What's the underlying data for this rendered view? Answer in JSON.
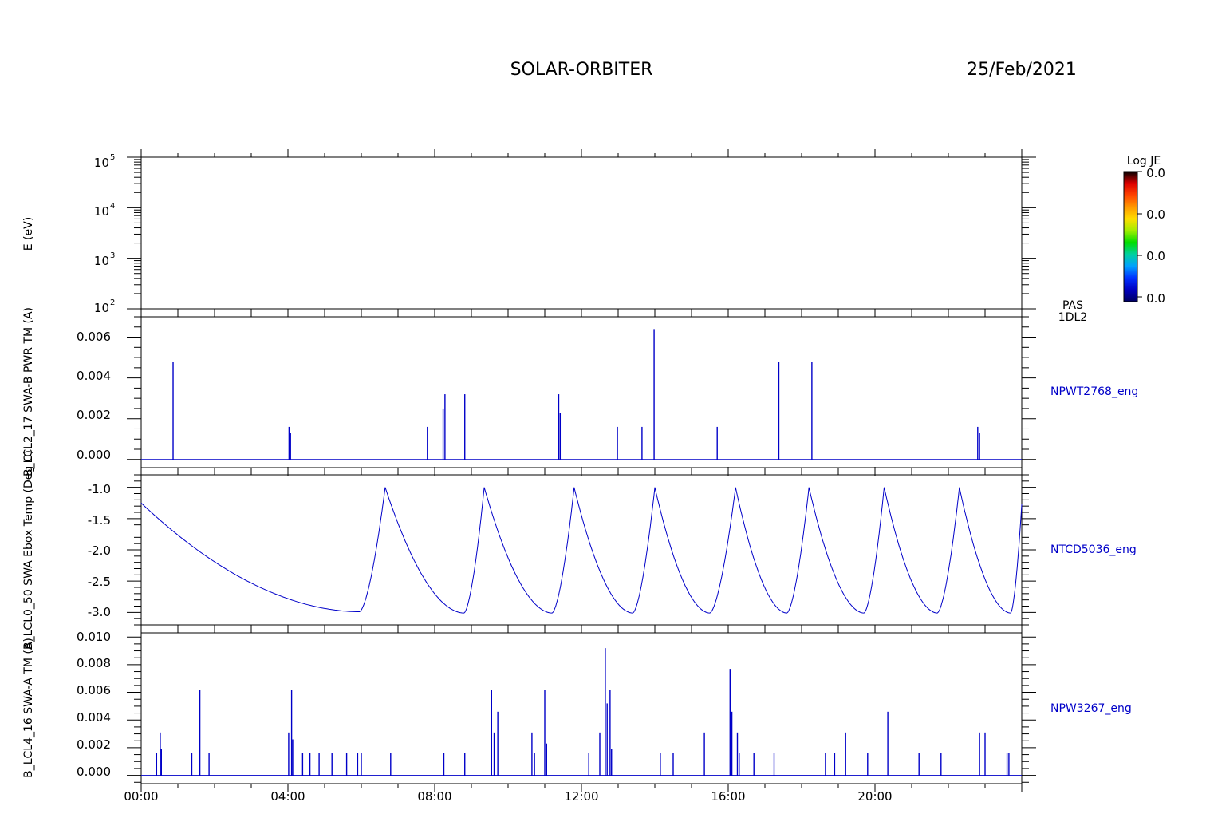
{
  "header": {
    "mission": "SOLAR-ORBITER",
    "date": "25/Feb/2021"
  },
  "colorbar": {
    "title": "Log JE",
    "tick_labels": [
      "0.0",
      "0.0",
      "0.0",
      "0.0"
    ],
    "colors": [
      "#000000",
      "#dd0000",
      "#ff4400",
      "#ff9900",
      "#ffdd00",
      "#a0ee00",
      "#00dd00",
      "#00d0a0",
      "#00a0ff",
      "#0030ff",
      "#0000c0",
      "#000060"
    ]
  },
  "x_axis": {
    "tick_labels": [
      "00:00",
      "04:00",
      "08:00",
      "12:00",
      "16:00",
      "20:00"
    ],
    "range_hours": [
      0,
      24
    ]
  },
  "chart_data": [
    {
      "type": "heatmap",
      "ylabel": "E (eV)",
      "yscale": "log",
      "ylim": [
        100,
        100000
      ],
      "tick_labels": [
        {
          "base": "10",
          "exp": "5"
        },
        {
          "base": "10",
          "exp": "4"
        },
        {
          "base": "10",
          "exp": "3"
        },
        {
          "base": "10",
          "exp": "2"
        }
      ],
      "side_label": [
        "PAS",
        "1DL2"
      ],
      "values": []
    },
    {
      "type": "line",
      "ylabel": "NPWT2768_eng",
      "left_label": "B_LCL2_17 SWA-B PWR TM (A)",
      "ylim": [
        -0.0004,
        0.007
      ],
      "tick_labels": [
        "0.006",
        "0.004",
        "0.002",
        "0.000"
      ],
      "tick_values": [
        0.006,
        0.004,
        0.002,
        0.0
      ],
      "spikes": [
        [
          0.87,
          0.0048
        ],
        [
          4.03,
          0.0016
        ],
        [
          4.07,
          0.0013
        ],
        [
          7.8,
          0.0016
        ],
        [
          8.23,
          0.0025
        ],
        [
          8.28,
          0.0032
        ],
        [
          8.82,
          0.0032
        ],
        [
          11.38,
          0.0032
        ],
        [
          11.42,
          0.0023
        ],
        [
          12.98,
          0.0016
        ],
        [
          13.65,
          0.0016
        ],
        [
          13.98,
          0.0064
        ],
        [
          15.7,
          0.0016
        ],
        [
          17.38,
          0.0048
        ],
        [
          18.28,
          0.0048
        ],
        [
          22.8,
          0.0016
        ],
        [
          22.85,
          0.0013
        ]
      ]
    },
    {
      "type": "line",
      "ylabel": "NTCD5036_eng",
      "left_label": "B_LCL0_50 SWA Ebox Temp (Deg C)",
      "ylim": [
        -3.2,
        -0.8
      ],
      "tick_labels": [
        "-1.0",
        "-1.5",
        "-2.0",
        "-2.5",
        "-3.0"
      ],
      "tick_values": [
        -1.0,
        -1.5,
        -2.0,
        -2.5,
        -3.0
      ],
      "peaks": [
        [
          6.65,
          -1.0
        ],
        [
          9.35,
          -1.0
        ],
        [
          11.8,
          -1.0
        ],
        [
          14.0,
          -1.0
        ],
        [
          16.2,
          -1.0
        ],
        [
          18.2,
          -1.0
        ],
        [
          20.25,
          -1.0
        ],
        [
          22.3,
          -1.0
        ]
      ],
      "troughs": [
        [
          5.95,
          -2.99
        ],
        [
          8.8,
          -3.01
        ],
        [
          11.2,
          -3.01
        ],
        [
          13.4,
          -3.01
        ],
        [
          15.5,
          -3.01
        ],
        [
          17.6,
          -3.01
        ],
        [
          19.7,
          -3.01
        ],
        [
          21.7,
          -3.01
        ],
        [
          23.7,
          -3.01
        ]
      ],
      "start": [
        0.0,
        -1.25
      ],
      "end": [
        24.0,
        -1.27
      ]
    },
    {
      "type": "line",
      "ylabel": "NPW3267_eng",
      "left_label": "B_LCL4_16 SWA-A TM (A)",
      "ylim": [
        -0.0006,
        0.0103
      ],
      "tick_labels": [
        "0.010",
        "0.008",
        "0.006",
        "0.004",
        "0.002",
        "0.000"
      ],
      "tick_values": [
        0.01,
        0.008,
        0.006,
        0.004,
        0.002,
        0.0
      ],
      "spikes": [
        [
          0.42,
          0.0016
        ],
        [
          0.52,
          0.0031
        ],
        [
          0.55,
          0.0019
        ],
        [
          1.38,
          0.0016
        ],
        [
          1.6,
          0.0062
        ],
        [
          1.85,
          0.0016
        ],
        [
          4.02,
          0.0031
        ],
        [
          4.1,
          0.0062
        ],
        [
          4.13,
          0.0026
        ],
        [
          4.4,
          0.0016
        ],
        [
          4.6,
          0.0016
        ],
        [
          4.85,
          0.0016
        ],
        [
          5.2,
          0.0016
        ],
        [
          5.6,
          0.0016
        ],
        [
          5.9,
          0.0016
        ],
        [
          6.0,
          0.0016
        ],
        [
          6.8,
          0.0016
        ],
        [
          8.25,
          0.0016
        ],
        [
          8.82,
          0.0016
        ],
        [
          9.55,
          0.0062
        ],
        [
          9.62,
          0.0031
        ],
        [
          9.72,
          0.0046
        ],
        [
          10.65,
          0.0031
        ],
        [
          10.72,
          0.0016
        ],
        [
          11.0,
          0.0062
        ],
        [
          11.05,
          0.0023
        ],
        [
          12.2,
          0.0016
        ],
        [
          12.5,
          0.0031
        ],
        [
          12.65,
          0.0092
        ],
        [
          12.7,
          0.0052
        ],
        [
          12.78,
          0.0062
        ],
        [
          12.82,
          0.0019
        ],
        [
          14.15,
          0.0016
        ],
        [
          14.5,
          0.0016
        ],
        [
          15.35,
          0.0031
        ],
        [
          16.05,
          0.0077
        ],
        [
          16.1,
          0.0046
        ],
        [
          16.25,
          0.0031
        ],
        [
          16.3,
          0.0016
        ],
        [
          16.7,
          0.0016
        ],
        [
          17.25,
          0.0016
        ],
        [
          18.65,
          0.0016
        ],
        [
          18.9,
          0.0016
        ],
        [
          19.2,
          0.0031
        ],
        [
          19.8,
          0.0016
        ],
        [
          20.35,
          0.0046
        ],
        [
          21.2,
          0.0016
        ],
        [
          21.8,
          0.0016
        ],
        [
          22.85,
          0.0031
        ],
        [
          23.0,
          0.0031
        ],
        [
          23.6,
          0.0016
        ],
        [
          23.65,
          0.0016
        ]
      ]
    }
  ]
}
